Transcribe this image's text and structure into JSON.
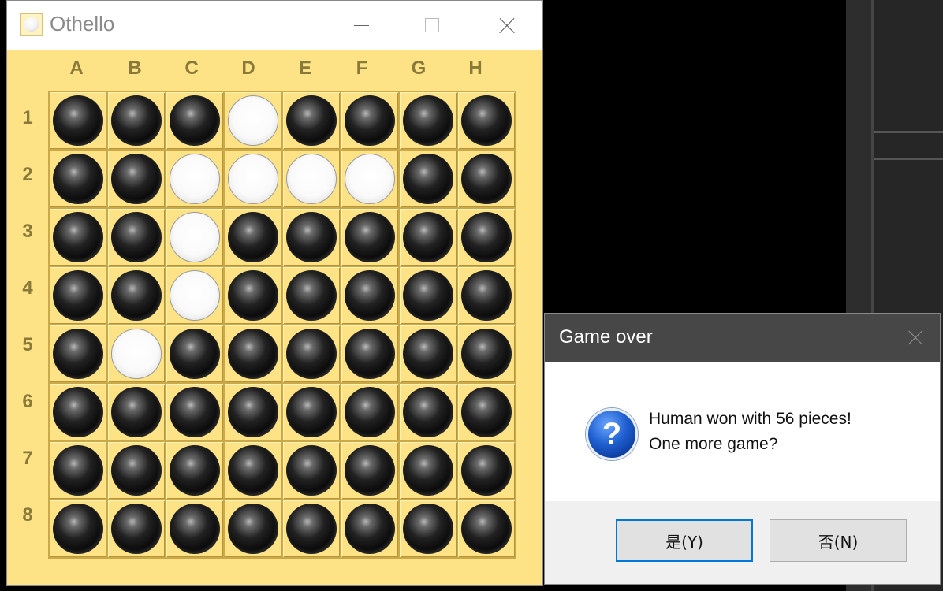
{
  "window": {
    "title": "Othello"
  },
  "board": {
    "columns": [
      "A",
      "B",
      "C",
      "D",
      "E",
      "F",
      "G",
      "H"
    ],
    "rows": [
      "1",
      "2",
      "3",
      "4",
      "5",
      "6",
      "7",
      "8"
    ],
    "cells": [
      "BBBWBBBB",
      "BBWWWWBB",
      "BBWBBBBB",
      "BBWBBBBB",
      "BWBBBBBB",
      "BBBBBBBB",
      "BBBBBBBB",
      "BBBBBBBB"
    ]
  },
  "dialog": {
    "title": "Game over",
    "message_line1": "Human won with 56 pieces!",
    "message_line2": "One more game?",
    "icon": "question-icon",
    "yes_label": "是(Y)",
    "no_label": "否(N)"
  }
}
